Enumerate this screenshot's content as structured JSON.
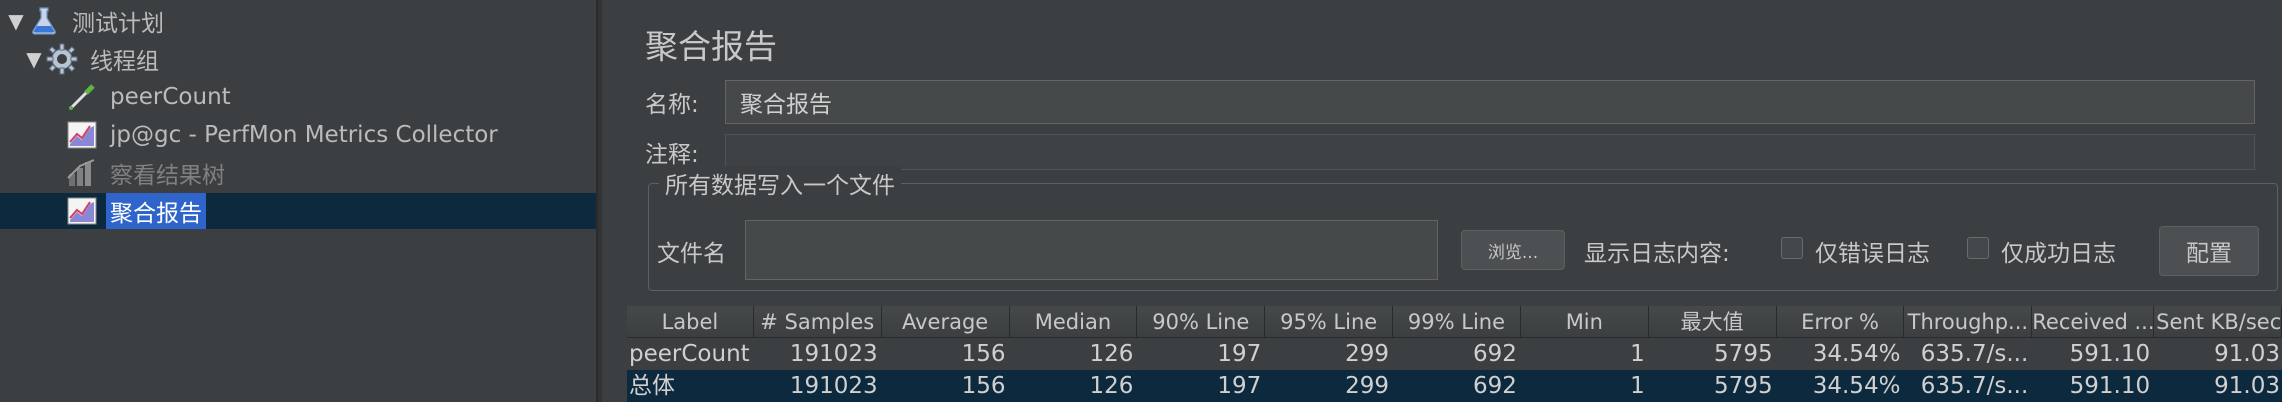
{
  "tree": {
    "items": [
      {
        "label": "测试计划",
        "icon": "flask-icon",
        "toggle": "▼"
      },
      {
        "label": "线程组",
        "icon": "gear-icon",
        "toggle": "▼"
      },
      {
        "label": "peerCount",
        "icon": "pipette-icon"
      },
      {
        "label": "jp@gc - PerfMon Metrics Collector",
        "icon": "graph-icon"
      },
      {
        "label": "察看结果树",
        "icon": "chart-icon"
      },
      {
        "label": "聚合报告",
        "icon": "graph-icon"
      }
    ]
  },
  "panel": {
    "title": "聚合报告",
    "name_label": "名称:",
    "name_value": "聚合报告",
    "comment_label": "注释:",
    "comment_value": "",
    "file_group_title": "所有数据写入一个文件",
    "filename_label": "文件名",
    "filename_value": "",
    "browse_button": "浏览...",
    "log_label": "显示日志内容:",
    "errors_only": "仅错误日志",
    "success_only": "仅成功日志",
    "config_button": "配置"
  },
  "table": {
    "columns": [
      "Label",
      "# Samples",
      "Average",
      "Median",
      "90% Line",
      "95% Line",
      "99% Line",
      "Min",
      "最大值",
      "Error %",
      "Throughp...",
      "Received ...",
      "Sent KB/sec"
    ],
    "rows": [
      [
        "peerCount",
        "191023",
        "156",
        "126",
        "197",
        "299",
        "692",
        "1",
        "5795",
        "34.54%",
        "635.7/s...",
        "591.10",
        "91.03"
      ],
      [
        "总体",
        "191023",
        "156",
        "126",
        "197",
        "299",
        "692",
        "1",
        "5795",
        "34.54%",
        "635.7/s...",
        "591.10",
        "91.03"
      ]
    ]
  }
}
